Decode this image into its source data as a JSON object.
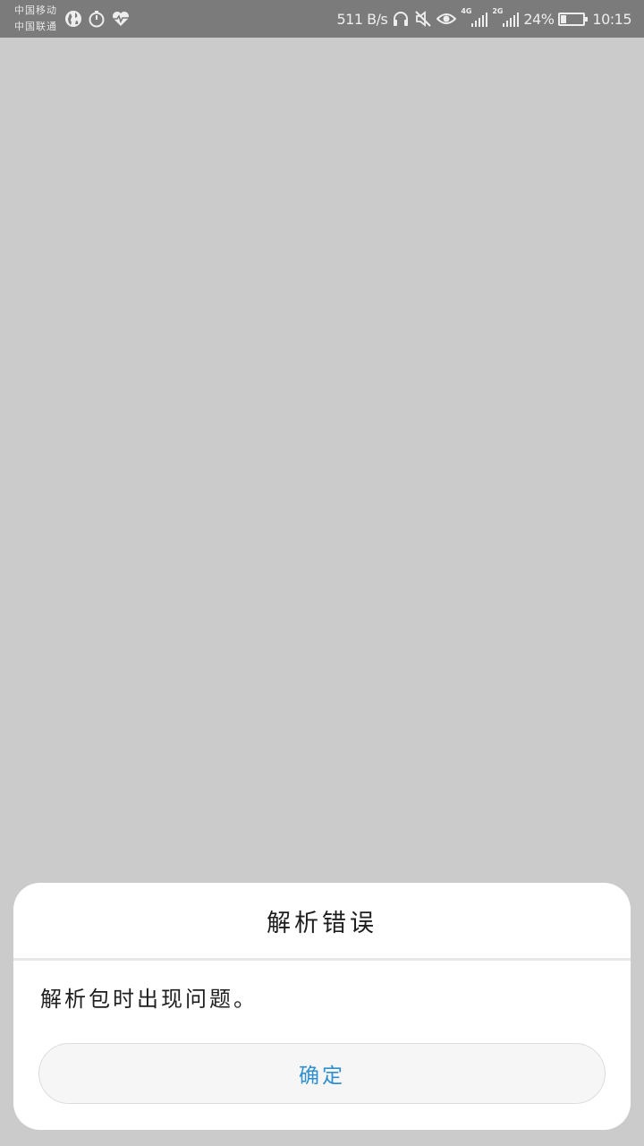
{
  "status_bar": {
    "carrier_1": "中国移动",
    "carrier_2": "中国联通",
    "left_icons": [
      "globe-icon",
      "stopwatch-icon",
      "heart-rate-icon"
    ],
    "net_speed": "511 B/s",
    "right_icons": [
      "headset-icon",
      "mute-icon",
      "eye-icon"
    ],
    "signal_1_label": "4G",
    "signal_2_label": "2G",
    "battery_percent": "24%",
    "battery_level": 0.24,
    "time": "10:15"
  },
  "colors": {
    "overlay": "#cbcbcb",
    "status_bar": "#7b7b7b",
    "dialog_bg": "#ffffff",
    "button_text": "#2f8fd0"
  },
  "dialog": {
    "title": "解析错误",
    "message": "解析包时出现问题。",
    "confirm_label": "确定"
  }
}
